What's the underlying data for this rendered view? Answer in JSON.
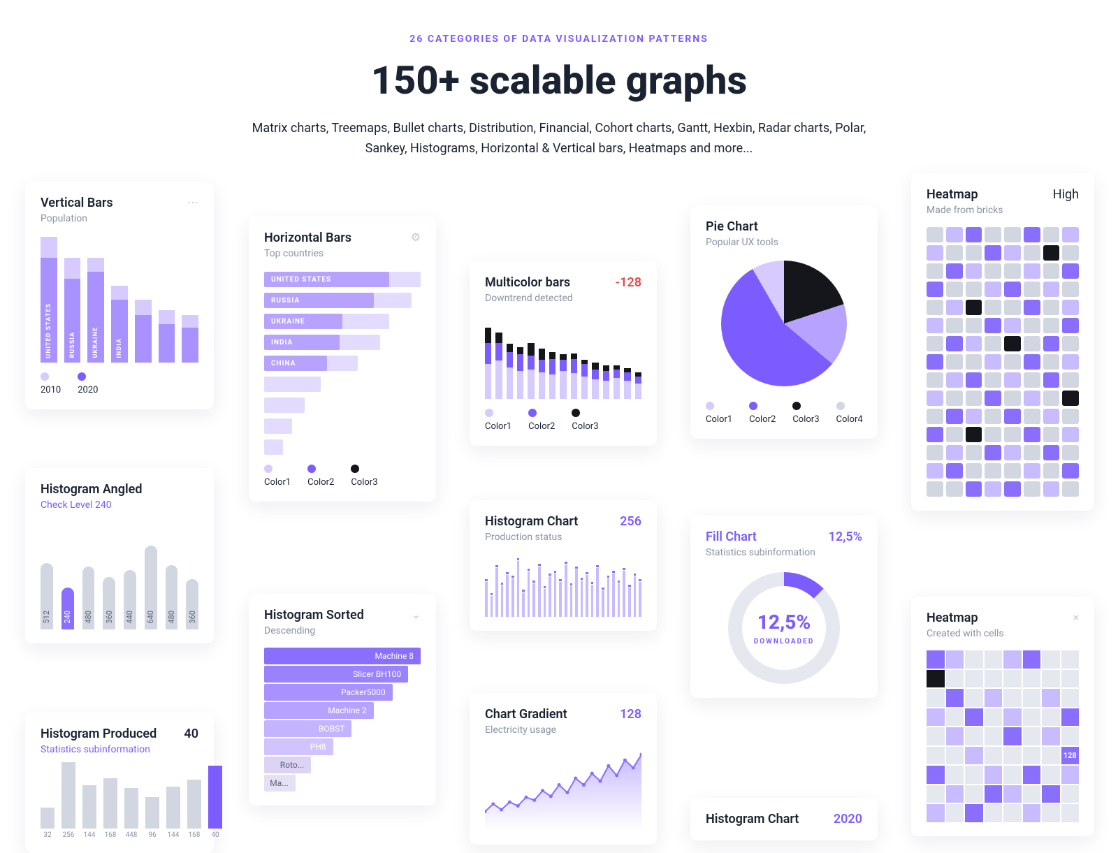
{
  "header": {
    "eyebrow": "26 CATEGORIES OF DATA VISUALIZATION PATTERNS",
    "title": "150+ scalable graphs",
    "subtitle": "Matrix charts, Treemaps, Bullet charts, Distribution, Financial, Cohort charts, Gantt, Hexbin, Radar charts, Polar, Sankey, Histograms, Horizontal & Vertical bars, Heatmaps and more..."
  },
  "vertical_bars": {
    "title": "Vertical Bars",
    "subtitle": "Population",
    "more_icon": "⋯",
    "legend": [
      {
        "swatch": "sw-light",
        "label": "2010"
      },
      {
        "swatch": "sw-purple",
        "label": "2020"
      }
    ]
  },
  "horizontal_bars": {
    "title": "Horizontal Bars",
    "subtitle": "Top countries",
    "gear_icon": "⚙",
    "legend": [
      {
        "swatch": "sw-light",
        "label": "Color1"
      },
      {
        "swatch": "sw-purple",
        "label": "Color2"
      },
      {
        "swatch": "sw-black",
        "label": "Color3"
      }
    ]
  },
  "histogram_angled": {
    "title": "Histogram Angled",
    "subtitle": "Check Level 240"
  },
  "histogram_produced": {
    "title": "Histogram Produced",
    "value": "40",
    "subtitle": "Statistics subinformation"
  },
  "histogram_sorted": {
    "title": "Histogram Sorted",
    "subtitle": "Descending",
    "chevron": "⌄"
  },
  "multicolor_bars": {
    "title": "Multicolor bars",
    "value": "-128",
    "subtitle": "Downtrend detected",
    "legend": [
      {
        "swatch": "sw-light",
        "label": "Color1"
      },
      {
        "swatch": "sw-purple",
        "label": "Color2"
      },
      {
        "swatch": "sw-black",
        "label": "Color3"
      }
    ]
  },
  "histogram_chart": {
    "title": "Histogram Chart",
    "value": "256",
    "subtitle": "Production status"
  },
  "chart_gradient": {
    "title": "Chart Gradient",
    "value": "128",
    "subtitle": "Electricity usage"
  },
  "pie_chart": {
    "title": "Pie Chart",
    "subtitle": "Popular UX tools",
    "legend": [
      {
        "swatch": "sw-light",
        "label": "Color1"
      },
      {
        "swatch": "sw-purple",
        "label": "Color2"
      },
      {
        "swatch": "sw-black",
        "label": "Color3"
      },
      {
        "swatch": "sw-grey",
        "label": "Color4"
      }
    ]
  },
  "fill_chart": {
    "title": "Fill Chart",
    "value": "12,5%",
    "subtitle": "Statistics subinformation",
    "center_value": "12,5%",
    "center_label": "DOWNLOADED"
  },
  "histogram_chart_2": {
    "title": "Histogram Chart",
    "value": "2020"
  },
  "heatmap_bricks": {
    "title": "Heatmap",
    "value": "High",
    "subtitle": "Made from bricks"
  },
  "heatmap_cells": {
    "title": "Heatmap",
    "close": "×",
    "subtitle": "Created with cells",
    "highlight_value": "128"
  },
  "chart_data": [
    {
      "id": "vertical_bars",
      "type": "bar",
      "categories": [
        "UNITED STATES",
        "RUSSIA",
        "UKRAINE",
        "INDIA",
        "",
        "",
        ""
      ],
      "series": [
        {
          "name": "2010",
          "values": [
            180,
            150,
            150,
            110,
            90,
            75,
            68
          ]
        },
        {
          "name": "2020",
          "values": [
            150,
            120,
            130,
            90,
            68,
            55,
            50
          ]
        }
      ],
      "ylim": [
        0,
        180
      ]
    },
    {
      "id": "horizontal_bars",
      "type": "bar",
      "orientation": "horizontal",
      "categories": [
        "UNITED STATES",
        "RUSSIA",
        "UKRAINE",
        "INDIA",
        "CHINA",
        "",
        "",
        "",
        ""
      ],
      "series": [
        {
          "name": "Color1",
          "values": [
            100,
            94,
            80,
            74,
            60,
            36,
            26,
            18,
            12
          ]
        },
        {
          "name": "Color2",
          "values": [
            80,
            70,
            50,
            48,
            40,
            0,
            0,
            0,
            0
          ]
        }
      ]
    },
    {
      "id": "histogram_angled",
      "type": "bar",
      "categories": [
        "512",
        "240",
        "480",
        "360",
        "440",
        "640",
        "480",
        "360"
      ],
      "values": [
        95,
        60,
        90,
        75,
        85,
        120,
        92,
        72
      ],
      "highlight_index": 1,
      "ylim": [
        0,
        150
      ]
    },
    {
      "id": "histogram_produced",
      "type": "bar",
      "categories": [
        "32",
        "256",
        "144",
        "168",
        "448",
        "96",
        "144",
        "168",
        "40"
      ],
      "values": [
        30,
        95,
        62,
        72,
        58,
        45,
        60,
        70,
        90
      ],
      "highlight_index": 8
    },
    {
      "id": "histogram_sorted",
      "type": "bar",
      "orientation": "horizontal",
      "categories": [
        "Machine 8",
        "Slicer BH100",
        "Packer5000",
        "Machine 2",
        "BOBST",
        "PH8",
        "Roto...",
        "Ma..."
      ],
      "values": [
        100,
        92,
        82,
        70,
        56,
        44,
        30,
        20
      ]
    },
    {
      "id": "multicolor_bars",
      "type": "bar",
      "stacked": true,
      "x": [
        1,
        2,
        3,
        4,
        5,
        6,
        7,
        8,
        9,
        10,
        11,
        12,
        13,
        14,
        15
      ],
      "series": [
        {
          "name": "Color1",
          "color": "#d6caff",
          "values": [
            50,
            55,
            45,
            40,
            42,
            38,
            35,
            40,
            37,
            32,
            28,
            26,
            30,
            26,
            22
          ]
        },
        {
          "name": "Color2",
          "color": "#7c5cff",
          "values": [
            30,
            25,
            22,
            24,
            20,
            18,
            22,
            16,
            20,
            18,
            14,
            14,
            12,
            12,
            10
          ]
        },
        {
          "name": "Color3",
          "color": "#14161c",
          "values": [
            22,
            15,
            12,
            10,
            18,
            16,
            10,
            8,
            8,
            6,
            10,
            8,
            6,
            6,
            6
          ]
        }
      ]
    },
    {
      "id": "histogram_chart",
      "type": "bar",
      "x_count": 30,
      "values": [
        50,
        30,
        70,
        45,
        60,
        55,
        80,
        35,
        65,
        48,
        72,
        40,
        58,
        62,
        50,
        75,
        44,
        68,
        52,
        60,
        46,
        70,
        38,
        55,
        62,
        48,
        66,
        42,
        58,
        50
      ]
    },
    {
      "id": "chart_gradient",
      "type": "area",
      "x": [
        0,
        1,
        2,
        3,
        4,
        5,
        6,
        7,
        8,
        9,
        10,
        11,
        12,
        13,
        14,
        15,
        16,
        17,
        18,
        19
      ],
      "values": [
        20,
        28,
        22,
        30,
        26,
        35,
        32,
        42,
        36,
        48,
        40,
        55,
        48,
        60,
        52,
        68,
        58,
        74,
        66,
        80
      ]
    },
    {
      "id": "pie_chart",
      "type": "pie",
      "slices": [
        {
          "name": "Color3",
          "color": "#14161c",
          "value": 20
        },
        {
          "name": "Color1",
          "color": "#b7a3ff",
          "value": 16
        },
        {
          "name": "Color2",
          "color": "#7c5cff",
          "value": 56
        },
        {
          "name": "Color4",
          "color": "#d6caff",
          "value": 8
        }
      ]
    },
    {
      "id": "fill_chart",
      "type": "pie",
      "slices": [
        {
          "name": "downloaded",
          "value": 12.5
        },
        {
          "name": "remaining",
          "value": 87.5
        }
      ]
    },
    {
      "id": "heatmap_bricks",
      "type": "heatmap",
      "rows": 15,
      "cols": 8,
      "levels": [
        "grey",
        "light-purple",
        "purple",
        "black"
      ]
    },
    {
      "id": "heatmap_cells",
      "type": "heatmap",
      "rows": 9,
      "cols": 8,
      "levels": [
        "grey",
        "light-purple",
        "purple",
        "black"
      ],
      "highlight": {
        "row": 5,
        "col": 7,
        "value": 128
      }
    }
  ]
}
